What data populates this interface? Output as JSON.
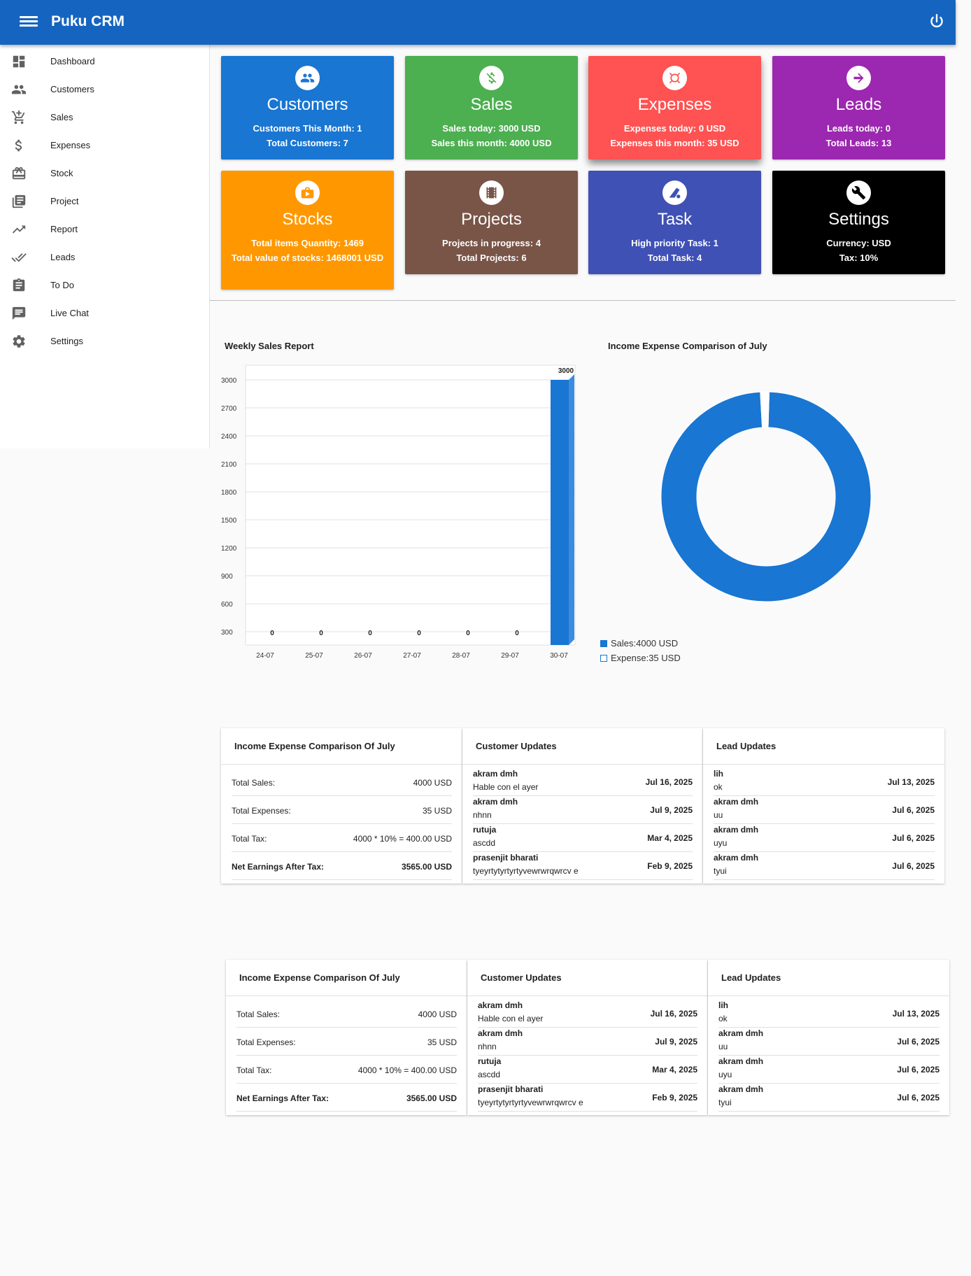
{
  "header": {
    "title": "Puku CRM"
  },
  "sidebar": {
    "items": [
      {
        "label": "Dashboard",
        "icon": "dashboard-icon"
      },
      {
        "label": "Customers",
        "icon": "people-icon"
      },
      {
        "label": "Sales",
        "icon": "cart-add-icon"
      },
      {
        "label": "Expenses",
        "icon": "dollar-icon"
      },
      {
        "label": "Stock",
        "icon": "gift-box-icon"
      },
      {
        "label": "Project",
        "icon": "library-icon"
      },
      {
        "label": "Report",
        "icon": "trending-up-icon"
      },
      {
        "label": "Leads",
        "icon": "done-all-icon"
      },
      {
        "label": "To Do",
        "icon": "clipboard-icon"
      },
      {
        "label": "Live Chat",
        "icon": "chat-icon"
      },
      {
        "label": "Settings",
        "icon": "gear-icon"
      }
    ]
  },
  "cards": [
    {
      "title": "Customers",
      "line1": "Customers This Month: 1",
      "line2": "Total Customers: 7",
      "color": "#1976d2",
      "icon": "people-icon"
    },
    {
      "title": "Sales",
      "line1": "Sales today: 3000 USD",
      "line2": "Sales this month: 4000 USD",
      "color": "#4caf50",
      "icon": "money-off-icon"
    },
    {
      "title": "Expenses",
      "line1": "Expenses today: 0 USD",
      "line2": "Expenses this month: 35 USD",
      "color": "#ff5252",
      "icon": "expense-icon"
    },
    {
      "title": "Leads",
      "line1": "Leads today: 0",
      "line2": "Total Leads: 13",
      "color": "#9c27b0",
      "icon": "arrow-right-icon"
    },
    {
      "title": "Stocks",
      "line1": "Total items Quantity: 1469",
      "line2": "Total value of stocks: 1468001 USD",
      "color": "#ff9800",
      "icon": "briefcase-play-icon"
    },
    {
      "title": "Projects",
      "line1": "Projects in progress: 4",
      "line2": "Total Projects: 6",
      "color": "#795548",
      "icon": "film-icon"
    },
    {
      "title": "Task",
      "line1": "High priority Task: 1",
      "line2": "Total Task: 4",
      "color": "#3f51b5",
      "icon": "task-icon"
    },
    {
      "title": "Settings",
      "line1": "Currency: USD",
      "line2": "Tax: 10%",
      "color": "#000000",
      "icon": "wrench-icon"
    }
  ],
  "chart_data": [
    {
      "type": "bar",
      "title": "Weekly Sales Report",
      "categories": [
        "24-07",
        "25-07",
        "26-07",
        "27-07",
        "28-07",
        "29-07",
        "30-07"
      ],
      "values": [
        0,
        0,
        0,
        0,
        0,
        0,
        3000
      ],
      "value_labels": [
        "0",
        "0",
        "0",
        "0",
        "0",
        "0",
        "3000"
      ],
      "yticks": [
        "3000",
        "2700",
        "2400",
        "2100",
        "1800",
        "1500",
        "1200",
        "900",
        "600",
        "300"
      ],
      "ylim": [
        300,
        3000
      ],
      "color": "#1976d2",
      "grid": true
    },
    {
      "type": "pie",
      "title": "Income Expense Comparison of July",
      "slices": [
        {
          "label": "Sales:4000 USD",
          "value": 4000,
          "color": "#1976d2"
        },
        {
          "label": "Expense:35 USD",
          "value": 35,
          "color": "#ffffff"
        }
      ],
      "legend": "bottom-left"
    }
  ],
  "panels": [
    {
      "income_title": "Income Expense Comparison Of July",
      "income_rows": [
        {
          "label": "Total Sales:",
          "value": "4000 USD"
        },
        {
          "label": "Total Expenses:",
          "value": "35 USD"
        },
        {
          "label": "Total Tax:",
          "value": "4000 * 10% = 400.00 USD"
        },
        {
          "label": "Net Earnings After Tax:",
          "value": "3565.00 USD"
        }
      ],
      "customer_title": "Customer Updates",
      "customer_rows": [
        {
          "name": "akram dmh",
          "note": "Hable con el ayer",
          "date": "Jul 16, 2025"
        },
        {
          "name": "akram dmh",
          "note": "nhnn",
          "date": "Jul 9, 2025"
        },
        {
          "name": "rutuja",
          "note": "ascdd",
          "date": "Mar 4, 2025"
        },
        {
          "name": "prasenjit bharati",
          "note": "tyeyrtytyrtyrtyvewrwrqwrcv e",
          "date": "Feb 9, 2025"
        }
      ],
      "lead_title": "Lead Updates",
      "lead_rows": [
        {
          "name": "lih",
          "note": "ok",
          "date": "Jul 13, 2025"
        },
        {
          "name": "akram dmh",
          "note": "uu",
          "date": "Jul 6, 2025"
        },
        {
          "name": "akram dmh",
          "note": "uyu",
          "date": "Jul 6, 2025"
        },
        {
          "name": "akram dmh",
          "note": "tyui",
          "date": "Jul 6, 2025"
        }
      ]
    }
  ]
}
